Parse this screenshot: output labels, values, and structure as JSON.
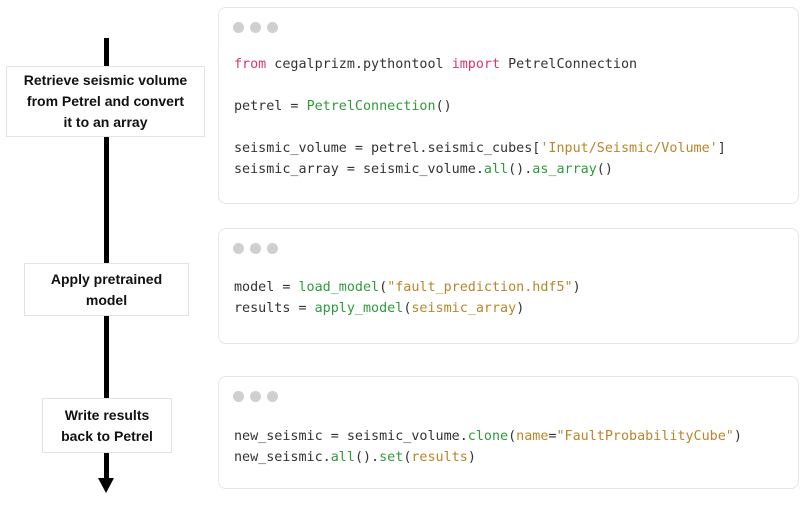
{
  "colors": {
    "keyword": "#d7396a",
    "class_name": "#2a2a2a",
    "function": "#2f9a3c",
    "string": "#b8862b",
    "parameter": "#b8862b",
    "plain": "#333333",
    "window_dot": "#cfcfcf",
    "arrow": "#000000"
  },
  "steps": [
    {
      "label": "Retrieve seismic volume\nfrom Petrel and convert\nit to an array"
    },
    {
      "label": "Apply pretrained\nmodel"
    },
    {
      "label": "Write results\nback to Petrel"
    }
  ],
  "code_blocks": [
    {
      "lines": [
        [
          [
            "from",
            "keyword"
          ],
          [
            " cegalprizm.pythontool ",
            "plain"
          ],
          [
            "import",
            "keyword"
          ],
          [
            " PetrelConnection",
            "plain"
          ]
        ],
        [],
        [
          [
            "petrel = ",
            "plain"
          ],
          [
            "PetrelConnection",
            "function"
          ],
          [
            "()",
            "plain"
          ]
        ],
        [],
        [
          [
            "seismic_volume = petrel.seismic_cubes[",
            "plain"
          ],
          [
            "'Input/Seismic/Volume'",
            "string"
          ],
          [
            "]",
            "plain"
          ]
        ],
        [
          [
            "seismic_array = seismic_volume.",
            "plain"
          ],
          [
            "all",
            "function"
          ],
          [
            "().",
            "plain"
          ],
          [
            "as_array",
            "function"
          ],
          [
            "()",
            "plain"
          ]
        ]
      ]
    },
    {
      "lines": [
        [
          [
            "model = ",
            "plain"
          ],
          [
            "load_model",
            "function"
          ],
          [
            "(",
            "plain"
          ],
          [
            "\"fault_prediction.hdf5\"",
            "string"
          ],
          [
            ")",
            "plain"
          ]
        ],
        [
          [
            "results = ",
            "plain"
          ],
          [
            "apply_model",
            "function"
          ],
          [
            "(",
            "plain"
          ],
          [
            "seismic_array",
            "parameter"
          ],
          [
            ")",
            "plain"
          ]
        ]
      ]
    },
    {
      "lines": [
        [
          [
            "new_seismic = seismic_volume.",
            "plain"
          ],
          [
            "clone",
            "function"
          ],
          [
            "(",
            "plain"
          ],
          [
            "name",
            "parameter"
          ],
          [
            "=",
            "plain"
          ],
          [
            "\"FaultProbabilityCube\"",
            "string"
          ],
          [
            ")",
            "plain"
          ]
        ],
        [
          [
            "new_seismic.",
            "plain"
          ],
          [
            "all",
            "function"
          ],
          [
            "().",
            "plain"
          ],
          [
            "set",
            "function"
          ],
          [
            "(",
            "plain"
          ],
          [
            "results",
            "parameter"
          ],
          [
            ")",
            "plain"
          ]
        ]
      ]
    }
  ]
}
